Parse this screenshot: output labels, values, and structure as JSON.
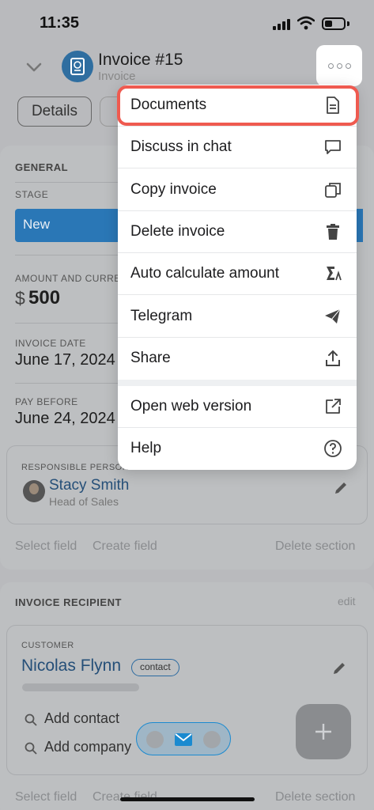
{
  "status": {
    "time": "11:35"
  },
  "header": {
    "title": "Invoice #15",
    "subtitle": "Invoice"
  },
  "tabs": {
    "details": "Details"
  },
  "general": {
    "section_title": "GENERAL",
    "stage_label": "STAGE",
    "stage_value": "New",
    "amount_label": "AMOUNT AND CURRE",
    "amount_currency": "$",
    "amount_value": "500",
    "invoice_date_label": "INVOICE DATE",
    "invoice_date_value": "June 17, 2024",
    "pay_before_label": "PAY BEFORE",
    "pay_before_value": "June 24, 2024",
    "responsible_label": "RESPONSIBLE PERSON",
    "responsible_name": "Stacy Smith",
    "responsible_title": "Head of Sales",
    "select_field": "Select field",
    "create_field": "Create field",
    "delete_section": "Delete section"
  },
  "recipient": {
    "section_title": "INVOICE RECIPIENT",
    "edit": "edit",
    "customer_label": "CUSTOMER",
    "customer_name": "Nicolas Flynn",
    "customer_badge": "contact",
    "add_contact": "Add contact",
    "add_company": "Add company",
    "select_field": "Select field",
    "create_field": "Create field",
    "delete_section": "Delete section"
  },
  "menu": {
    "items": [
      {
        "label": "Documents",
        "icon": "document-icon"
      },
      {
        "label": "Discuss in chat",
        "icon": "chat-icon"
      },
      {
        "label": "Copy invoice",
        "icon": "copy-icon"
      },
      {
        "label": "Delete invoice",
        "icon": "trash-icon"
      },
      {
        "label": "Auto calculate amount",
        "icon": "sigma-icon"
      },
      {
        "label": "Telegram",
        "icon": "telegram-icon"
      },
      {
        "label": "Share",
        "icon": "share-icon"
      },
      {
        "label": "Open web version",
        "icon": "external-link-icon"
      },
      {
        "label": "Help",
        "icon": "help-icon"
      }
    ],
    "highlight_color": "#ef5a50"
  },
  "colors": {
    "accent": "#2a77b6",
    "link": "#254f78"
  }
}
